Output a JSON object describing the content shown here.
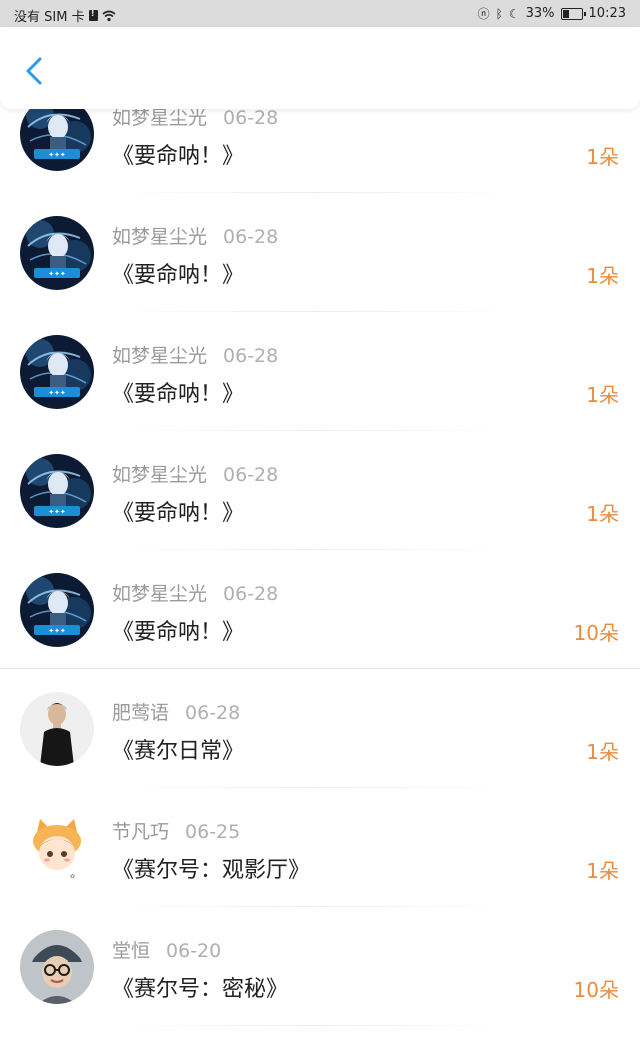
{
  "status_bar": {
    "carrier": "没有 SIM 卡",
    "battery": "33%",
    "battery_level": 0.33,
    "time": "10:23"
  },
  "header": {
    "back_icon": "chevron-left-icon",
    "accent": "#2d9ae8"
  },
  "records": [
    {
      "name": "如梦星尘光",
      "date": "06-28",
      "title": "《要命呐！》",
      "amount": "1朵",
      "avatar": "anime-boy"
    },
    {
      "name": "如梦星尘光",
      "date": "06-28",
      "title": "《要命呐！》",
      "amount": "1朵",
      "avatar": "anime-boy"
    },
    {
      "name": "如梦星尘光",
      "date": "06-28",
      "title": "《要命呐！》",
      "amount": "1朵",
      "avatar": "anime-boy"
    },
    {
      "name": "如梦星尘光",
      "date": "06-28",
      "title": "《要命呐！》",
      "amount": "1朵",
      "avatar": "anime-boy"
    },
    {
      "name": "如梦星尘光",
      "date": "06-28",
      "title": "《要命呐！》",
      "amount": "10朵",
      "avatar": "anime-boy"
    },
    {
      "name": "肥莺语",
      "date": "06-28",
      "title": "《赛尔日常》",
      "amount": "1朵",
      "avatar": "person-photo"
    },
    {
      "name": "节凡巧",
      "date": "06-25",
      "title": "《赛尔号：观影厅》",
      "amount": "1朵",
      "avatar": "cartoon-cat-girl"
    },
    {
      "name": "堂恒",
      "date": "06-20",
      "title": "《赛尔号：密秘》",
      "amount": "10朵",
      "avatar": "child-photo"
    }
  ],
  "colors": {
    "amount": "#e98c3f",
    "name": "#9a9a9a",
    "title": "#222222"
  }
}
